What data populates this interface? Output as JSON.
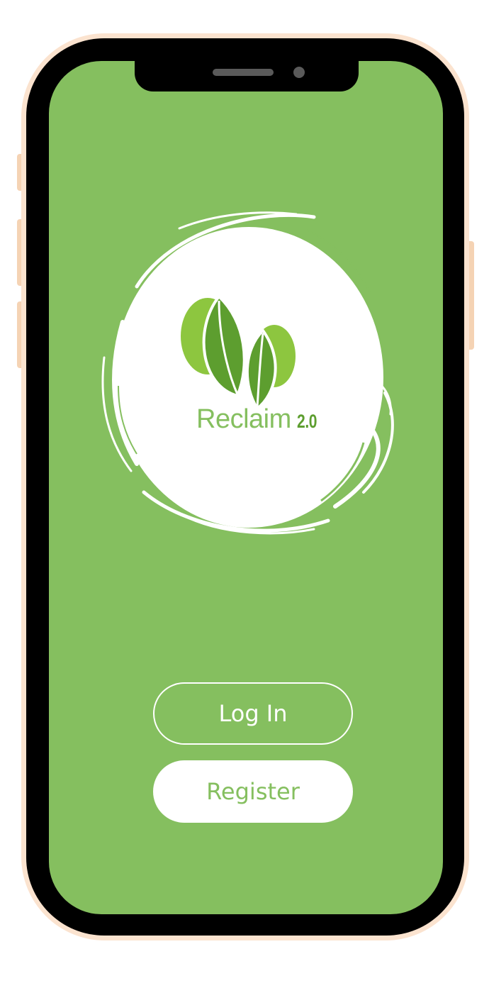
{
  "app": {
    "name": "Reclaim",
    "version": "2.0"
  },
  "colors": {
    "screen_background": "#85bf5f",
    "frame": "#fbe3cf",
    "leaf_light": "#8dc63f",
    "leaf_dark": "#5d9e2f"
  },
  "actions": {
    "login_label": "Log In",
    "register_label": "Register"
  },
  "icons": [
    "leaf-logo-icon",
    "brush-circle-icon"
  ]
}
